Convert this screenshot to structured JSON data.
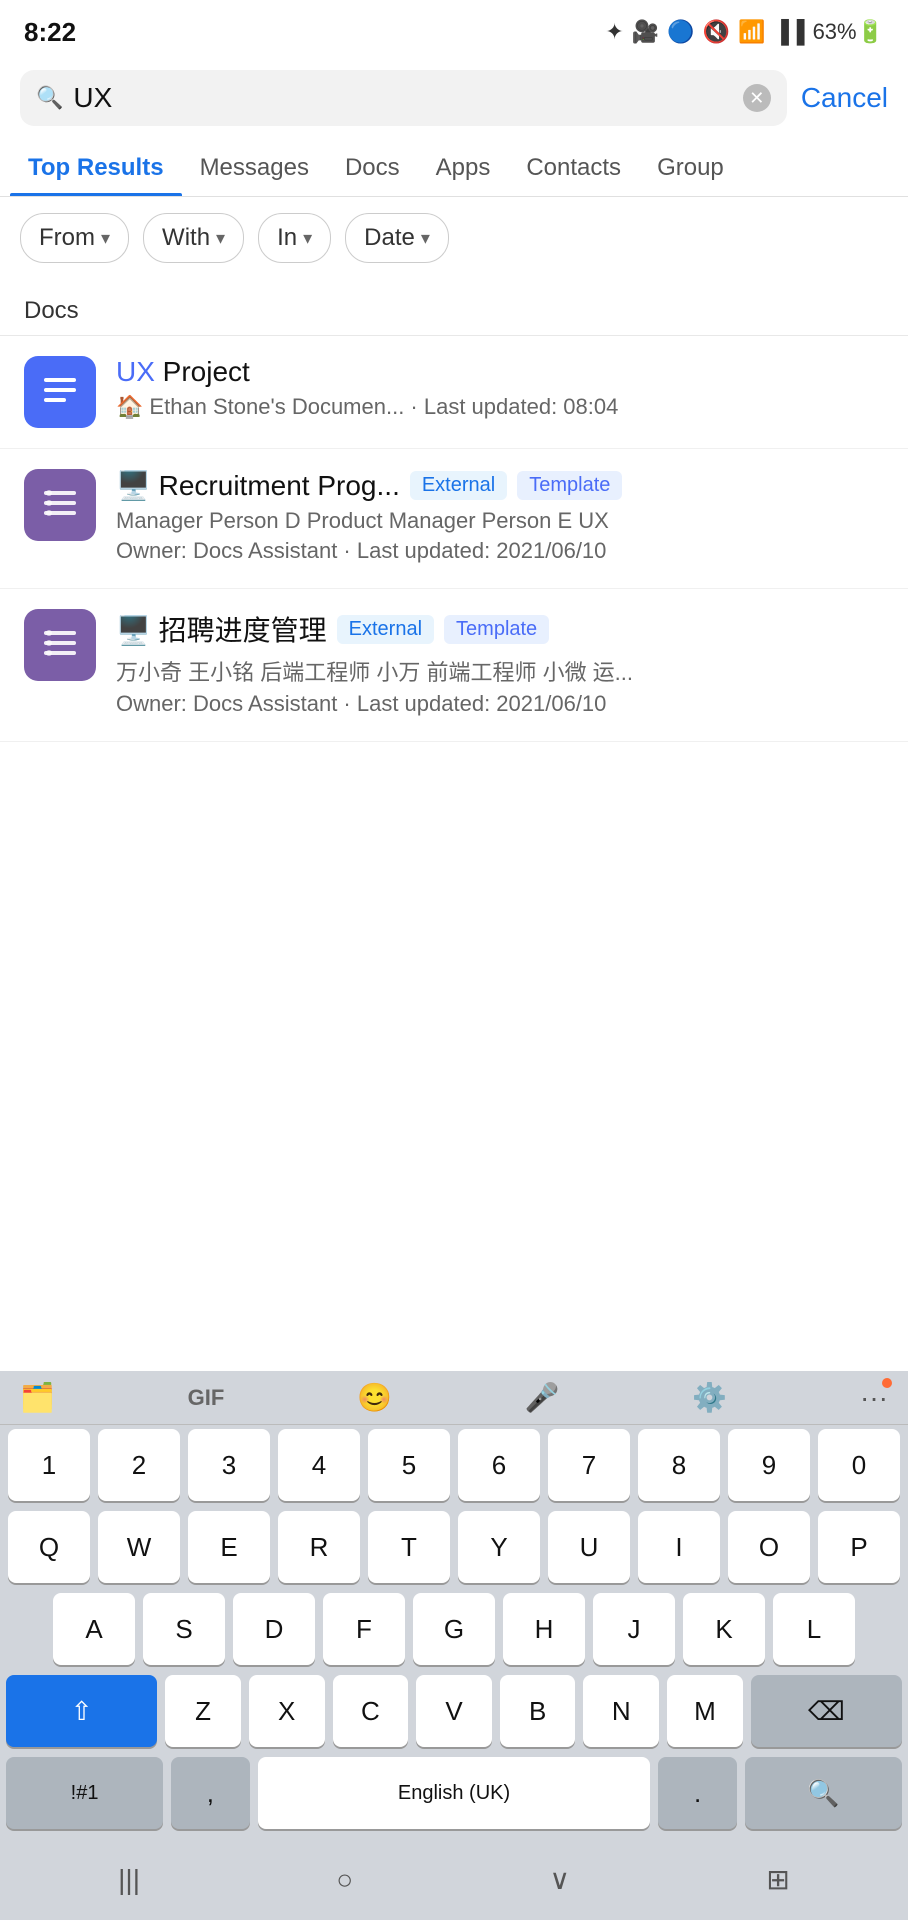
{
  "statusBar": {
    "time": "8:22",
    "icons": [
      "✦",
      "🎥",
      "🔵",
      "🔇",
      "📶",
      "63%",
      "🔋"
    ]
  },
  "search": {
    "query": "UX",
    "placeholder": "Search",
    "clearAriaLabel": "clear",
    "cancelLabel": "Cancel"
  },
  "tabs": [
    {
      "id": "top",
      "label": "Top Results",
      "active": true
    },
    {
      "id": "messages",
      "label": "Messages",
      "active": false
    },
    {
      "id": "docs",
      "label": "Docs",
      "active": false
    },
    {
      "id": "apps",
      "label": "Apps",
      "active": false
    },
    {
      "id": "contacts",
      "label": "Contacts",
      "active": false
    },
    {
      "id": "groups",
      "label": "Group",
      "active": false
    }
  ],
  "filters": [
    {
      "id": "from",
      "label": "From",
      "hasChevron": true
    },
    {
      "id": "with",
      "label": "With",
      "hasChevron": true
    },
    {
      "id": "in",
      "label": "In",
      "hasChevron": true
    },
    {
      "id": "date",
      "label": "Date",
      "hasChevron": true
    }
  ],
  "sectionLabel": "Docs",
  "docResults": [
    {
      "id": "doc1",
      "iconType": "blue",
      "titleHighlight": "UX",
      "titleRest": " Project",
      "metaIcon": "🏠",
      "metaText": "Ethan Stone's Documen... · Last updated: 08:04",
      "badges": [],
      "bodyText": ""
    },
    {
      "id": "doc2",
      "iconType": "purple",
      "titleIcon": "🖥️",
      "titleText": " Recruitment Prog...",
      "metaIcon": "",
      "metaText": "Manager Person D Product Manager Person E UX",
      "metaText2": "Owner: Docs Assistant · Last updated: 2021/06/10",
      "badges": [
        "External",
        "Template"
      ],
      "bodyText": "",
      "hasUXHighlight": true
    },
    {
      "id": "doc3",
      "iconType": "purple",
      "titleIcon": "🖥️",
      "titleText": " 招聘进度管理",
      "metaIcon": "",
      "metaText": "万小奇 王小铭 后端工程师 小万 前端工程师 小微 运...",
      "metaText2": "Owner: Docs Assistant · Last updated: 2021/06/10",
      "badges": [
        "External",
        "Template"
      ],
      "bodyText": ""
    }
  ],
  "keyboard": {
    "toolbar": {
      "icons": [
        "sticker",
        "gif",
        "emoji",
        "mic",
        "settings",
        "more"
      ]
    },
    "rows": [
      [
        "1",
        "2",
        "3",
        "4",
        "5",
        "6",
        "7",
        "8",
        "9",
        "0"
      ],
      [
        "Q",
        "W",
        "E",
        "R",
        "T",
        "Y",
        "U",
        "I",
        "O",
        "P"
      ],
      [
        "A",
        "S",
        "D",
        "F",
        "G",
        "H",
        "J",
        "K",
        "L"
      ],
      [
        "⇧",
        "Z",
        "X",
        "C",
        "V",
        "B",
        "N",
        "M",
        "⌫"
      ],
      [
        "!#1",
        ",",
        "English (UK)",
        ".",
        "🔍"
      ]
    ]
  },
  "bottomNav": [
    "|||",
    "○",
    "∨",
    "⊞"
  ]
}
